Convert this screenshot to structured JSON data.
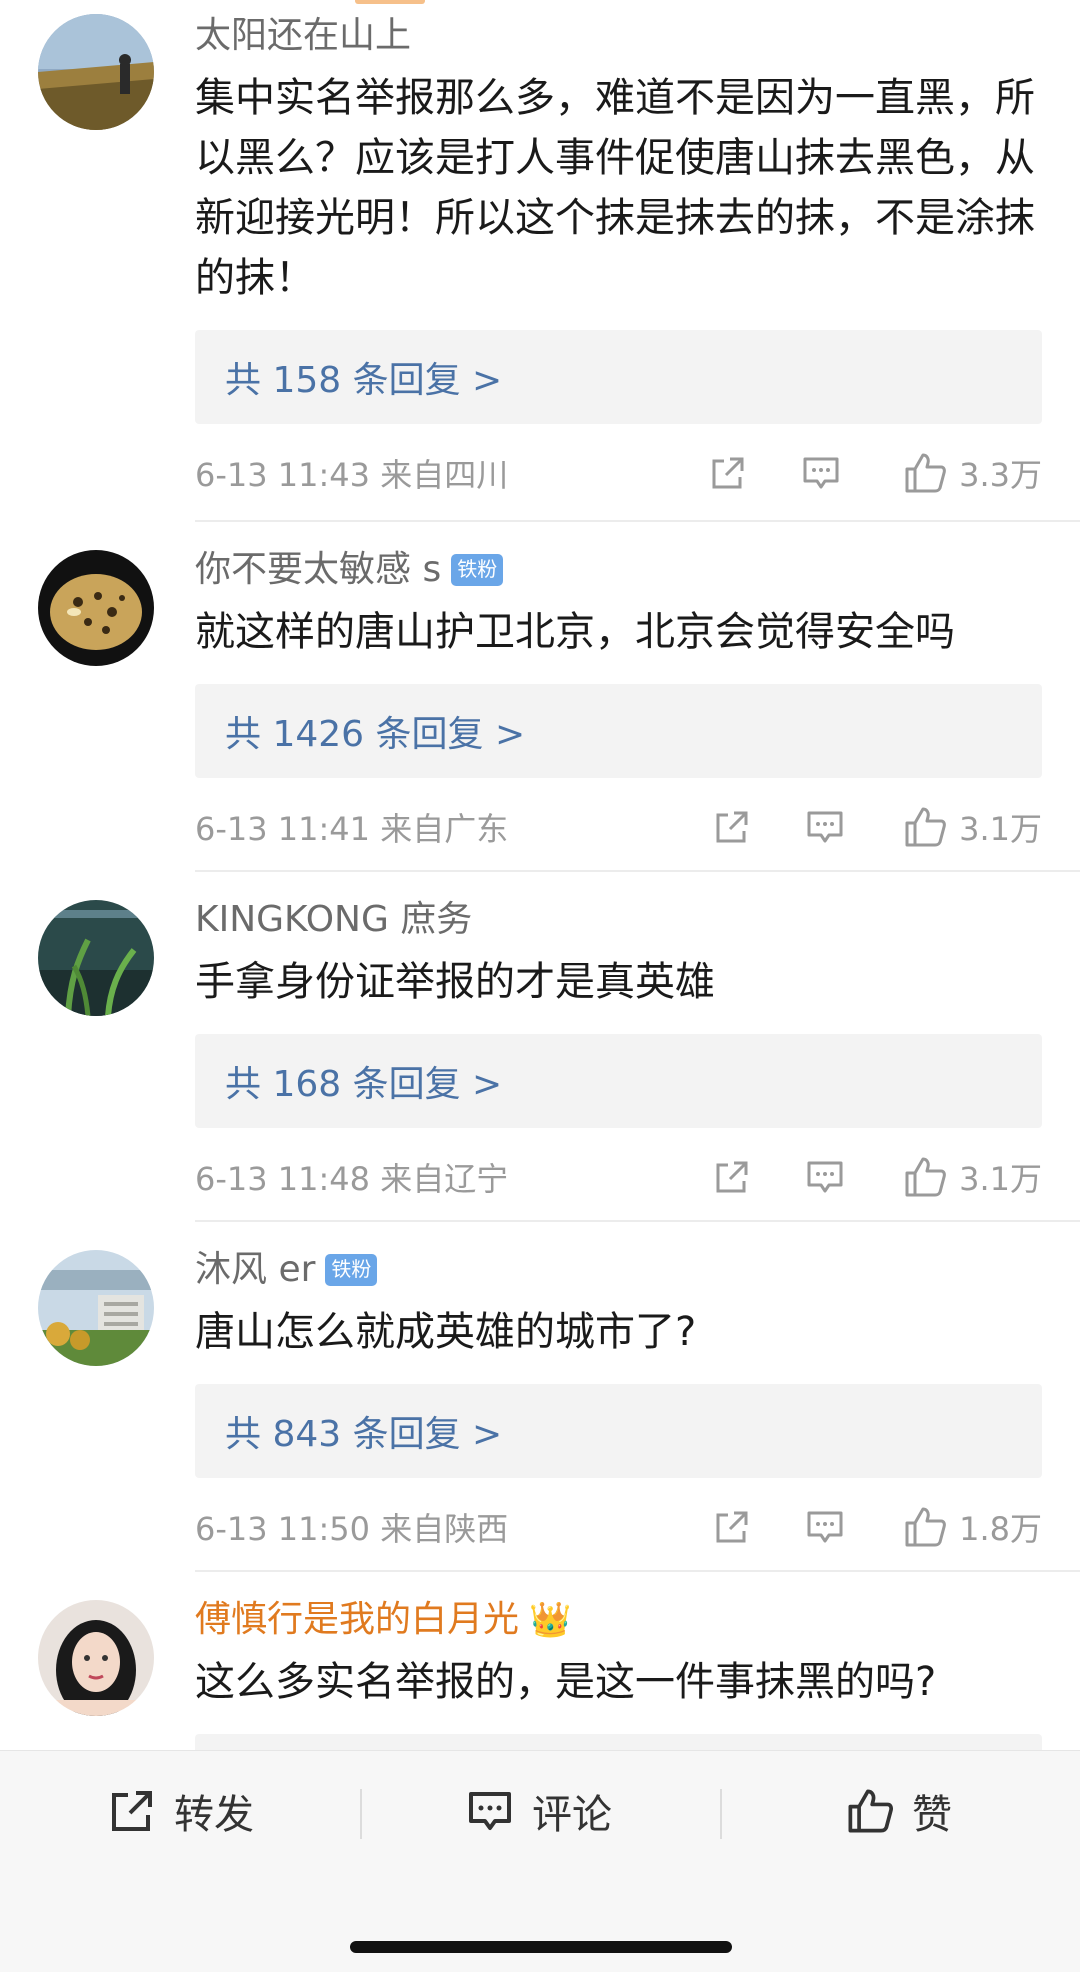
{
  "comments": [
    {
      "username": "太阳还在山上",
      "text": "集中实名举报那么多，难道不是因为一直黑，所以黑么？应该是打人事件促使唐山抹去黑色，从新迎接光明！所以这个抹是抹去的抹，不是涂抹的抹！",
      "replies": "共 158 条回复 >",
      "meta": "6-13 11:43  来自四川",
      "likes": "3.3万"
    },
    {
      "username": "你不要太敏感 s",
      "badge": "铁粉",
      "text": "就这样的唐山护卫北京，北京会觉得安全吗",
      "replies": "共 1426 条回复 >",
      "meta": "6-13 11:41  来自广东",
      "likes": "3.1万"
    },
    {
      "username": "KINGKONG 庶务",
      "text": "手拿身份证举报的才是真英雄",
      "replies": "共 168 条回复 >",
      "meta": "6-13 11:48  来自辽宁",
      "likes": "3.1万"
    },
    {
      "username": "沐风 er",
      "badge": "铁粉",
      "text": "唐山怎么就成英雄的城市了?",
      "replies": "共 843 条回复 >",
      "meta": "6-13 11:50  来自陕西",
      "likes": "1.8万"
    },
    {
      "username": "傅慎行是我的白月光",
      "text": "这么多实名举报的，是这一件事抹黑的吗?"
    }
  ],
  "bottom_bar": {
    "repost": "转发",
    "comment": "评论",
    "like": "赞"
  },
  "colors": {
    "reply_link": "#4a72a6",
    "badge": "#6aa6e8",
    "gold_username": "#e07a1f"
  }
}
